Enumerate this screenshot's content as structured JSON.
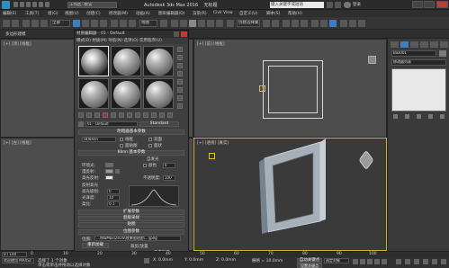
{
  "titlebar": {
    "workspace": "工作区: 默认",
    "app_title": "Autodesk 3ds Max 2016",
    "file_name": "无标题",
    "search_placeholder": "键入关键字或短语",
    "login": "登录"
  },
  "menubar": {
    "items": [
      "编辑(E)",
      "工具(T)",
      "组(G)",
      "视图(V)",
      "创建(C)",
      "修改器(M)",
      "动画(A)",
      "图形编辑器(D)",
      "渲染(R)",
      "Civil View",
      "自定义(U)",
      "脚本(S)",
      "帮助(H)"
    ]
  },
  "toolbar": {
    "selection_filter": "全部",
    "view_dropdown": "视图",
    "named_sel": "创建选择集"
  },
  "ribbon": {
    "label": "多边形建模"
  },
  "material_editor": {
    "title": "材质编辑器 - 01 - Default",
    "menu": "模式(D)  材质(M)  导航(N)  选项(O)  实用程序(U)",
    "material_name": "01 - Default",
    "material_type": "Standard",
    "rollouts": {
      "shader": "明暗器基本参数",
      "shader_type": "(B)Blinn",
      "wire": "线框",
      "two_sided": "双面",
      "face_map": "面贴图",
      "faceted": "面状",
      "blinn_basic": "Blinn 基本参数",
      "self_illum": "自发光",
      "color": "颜色",
      "ambient": "环境光:",
      "diffuse": "漫反射:",
      "specular": "高光反射:",
      "opacity": "不透明度:",
      "opacity_value": "100",
      "self_illum_value": "0",
      "spec_highlights": "反射高光",
      "spec_level": "高光级别:",
      "spec_level_value": "0",
      "glossiness": "光泽度:",
      "glossiness_value": "10",
      "soften": "柔化:",
      "soften_value": "0.1",
      "extended": "扩展参数",
      "supersampling": "超级采样",
      "maps": "贴图",
      "bitmap_params": "位图参数",
      "bitmap_label": "位图:",
      "bitmap_path": "...\\WaMax\\2016\\效果图贴图\\...\\jpeg",
      "reload": "重新加载",
      "cropping": "裁剪/放置",
      "filtering": "过滤",
      "pyramidal": "四棱锥",
      "summed_area": "总面积",
      "none": "无",
      "apply": "应用",
      "view_image": "查看图像"
    }
  },
  "viewports": {
    "top_left": "[+] [顶] [线框]",
    "top_right": "[+] [前] [线框]",
    "bottom_left": "[+] [左] [线框]",
    "bottom_right": "[+] [透视] [真实]"
  },
  "command_panel": {
    "object_name": "Box001",
    "modifier_list": "修改器列表"
  },
  "timeline": {
    "frame": "0 / 100",
    "ticks": [
      "0",
      "10",
      "20",
      "30",
      "40",
      "50",
      "60",
      "70",
      "80",
      "90",
      "100"
    ]
  },
  "statusbar": {
    "selected": "选择了 1 个对象",
    "hint": "单击或单击并拖动以选择对象",
    "x": "X: 0.0mm",
    "y": "Y: 0.0mm",
    "z": "Z: 0.0mm",
    "grid": "栅格 = 10.0mm",
    "auto_key": "自动关键点",
    "set_key": "设置关键点",
    "selected_filter": "选定对象",
    "welcome": "欢迎使用 MAXSc"
  }
}
